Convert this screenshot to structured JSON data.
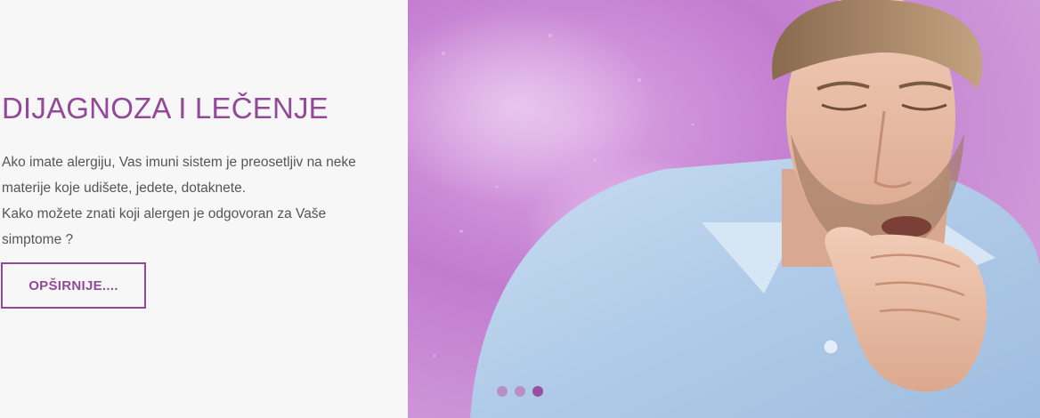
{
  "slide": {
    "headline": "DIJAGNOZA I LEČENJE",
    "paragraph_1": "Ako imate alergiju, Vas imuni sistem je preosetljiv na neke materije koje udišete, jedete, dotaknete.",
    "paragraph_2": "Kako možete znati koji alergen je odgovoran za Vaše simptome ?",
    "cta_label": "OPŠIRNIJE....",
    "image": "man-coughing-photo"
  },
  "slider_dots": {
    "count": 3,
    "active_index": 2
  },
  "colors": {
    "accent": "#94489a",
    "text": "#555555",
    "background": "#f7f7f7",
    "dot_inactive": "#b78fc2",
    "dot_active": "#9a4ea4"
  }
}
